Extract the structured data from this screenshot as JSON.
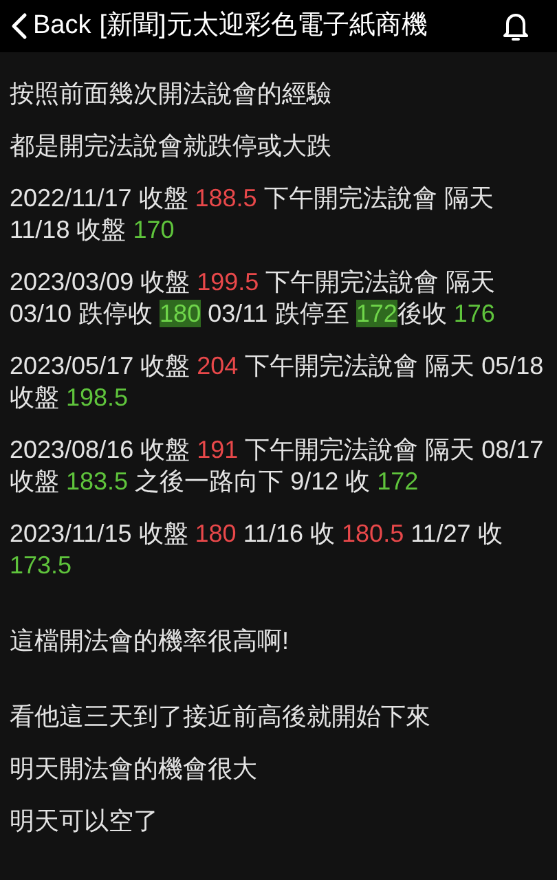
{
  "header": {
    "back_label": "Back",
    "title": "[新聞]元太迎彩色電子紙商機"
  },
  "sections": [
    {
      "paragraphs": [
        {
          "segments": [
            {
              "kind": "text",
              "text": "按照前面幾次開法說會的經驗"
            }
          ]
        },
        {
          "segments": [
            {
              "kind": "text",
              "text": "都是開完法說會就跌停或大跌"
            }
          ]
        },
        {
          "segments": [
            {
              "kind": "text",
              "text": "2022/11/17 收盤 "
            },
            {
              "kind": "up",
              "text": "188.5"
            },
            {
              "kind": "text",
              "text": "  下午開完法說會 隔天 11/18 收盤 "
            },
            {
              "kind": "down",
              "text": "170"
            }
          ]
        },
        {
          "segments": [
            {
              "kind": "text",
              "text": "2023/03/09 收盤 "
            },
            {
              "kind": "up",
              "text": "199.5"
            },
            {
              "kind": "text",
              "text": "  下午開完法說會 隔天 03/10 跌停收 "
            },
            {
              "kind": "down_marked",
              "text": "180"
            },
            {
              "kind": "text",
              "text": " 03/11 跌停至 "
            },
            {
              "kind": "down_marked",
              "text": "172"
            },
            {
              "kind": "text",
              "text": "後收 "
            },
            {
              "kind": "down",
              "text": "176"
            }
          ]
        },
        {
          "segments": [
            {
              "kind": "text",
              "text": "2023/05/17 收盤 "
            },
            {
              "kind": "up",
              "text": "204"
            },
            {
              "kind": "text",
              "text": "    下午開完法說會 隔天 05/18 收盤 "
            },
            {
              "kind": "down",
              "text": "198.5"
            }
          ]
        },
        {
          "segments": [
            {
              "kind": "text",
              "text": "2023/08/16 收盤 "
            },
            {
              "kind": "up",
              "text": "191"
            },
            {
              "kind": "text",
              "text": "    下午開完法說會 隔天 08/17 收盤 "
            },
            {
              "kind": "down",
              "text": "183.5"
            },
            {
              "kind": "text",
              "text": " 之後一路向下 9/12 收 "
            },
            {
              "kind": "down",
              "text": "172"
            }
          ]
        },
        {
          "segments": [
            {
              "kind": "text",
              "text": "2023/11/15 收盤 "
            },
            {
              "kind": "up",
              "text": "180"
            },
            {
              "kind": "text",
              "text": "    11/16 收 "
            },
            {
              "kind": "up",
              "text": "180.5"
            },
            {
              "kind": "text",
              "text": "  11/27 收 "
            },
            {
              "kind": "down",
              "text": "173.5"
            }
          ]
        }
      ]
    },
    {
      "paragraphs": [
        {
          "segments": [
            {
              "kind": "text",
              "text": "這檔開法會的機率很高啊!"
            }
          ]
        }
      ]
    },
    {
      "paragraphs": [
        {
          "segments": [
            {
              "kind": "text",
              "text": "看他這三天到了接近前高後就開始下來"
            }
          ]
        },
        {
          "segments": [
            {
              "kind": "text",
              "text": "明天開法會的機會很大"
            }
          ]
        },
        {
          "segments": [
            {
              "kind": "text",
              "text": "明天可以空了"
            }
          ]
        }
      ]
    }
  ]
}
